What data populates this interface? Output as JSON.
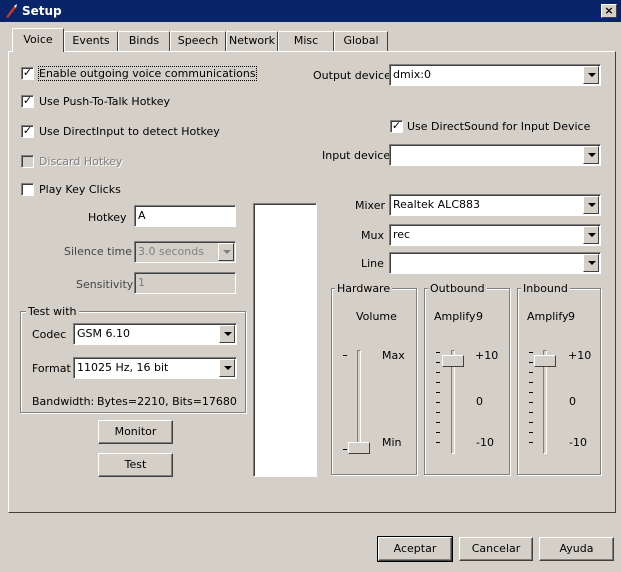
{
  "window": {
    "title": "Setup",
    "close_glyph": "×"
  },
  "tabs": [
    "Voice",
    "Events",
    "Binds",
    "Speech",
    "Network",
    "Misc",
    "Global"
  ],
  "voice": {
    "enable_outgoing": {
      "label": "Enable outgoing voice communications",
      "checked": true
    },
    "push_to_talk": {
      "label": "Use Push-To-Talk Hotkey",
      "checked": true
    },
    "direct_input": {
      "label": "Use DirectInput to detect Hotkey",
      "checked": true
    },
    "discard_hotkey": {
      "label": "Discard Hotkey",
      "checked": false,
      "disabled": true
    },
    "play_key_clicks": {
      "label": "Play Key Clicks",
      "checked": false
    },
    "hotkey": {
      "label": "Hotkey",
      "value": "A"
    },
    "silence_time": {
      "label": "Silence time",
      "value": "3.0 seconds"
    },
    "sensitivity": {
      "label": "Sensitivity",
      "value": "1"
    },
    "test_with": {
      "title": "Test with",
      "codec_label": "Codec",
      "codec_value": "GSM 6.10",
      "format_label": "Format",
      "format_value": "11025 Hz, 16 bit",
      "bandwidth_label": "Bandwidth:",
      "bandwidth_value": "Bytes=2210, Bits=17680"
    },
    "monitor_button": "Monitor",
    "test_button": "Test",
    "output_device": {
      "label": "Output device",
      "value": "dmix:0"
    },
    "use_directsound": {
      "label": "Use DirectSound for Input Device",
      "checked": true
    },
    "input_device": {
      "label": "Input device",
      "value": ""
    },
    "mixer": {
      "label": "Mixer",
      "value": "Realtek ALC883"
    },
    "mux": {
      "label": "Mux",
      "value": "rec"
    },
    "line": {
      "label": "Line",
      "value": ""
    },
    "hardware": {
      "title": "Hardware",
      "caption": "Volume",
      "max": "Max",
      "min": "Min",
      "level": 0.0
    },
    "outbound": {
      "title": "Outbound",
      "caption": "Amplify",
      "amount": "9",
      "top": "+10",
      "mid": "0",
      "bottom": "-10",
      "level": 0.95
    },
    "inbound": {
      "title": "Inbound",
      "caption": "Amplify",
      "amount": "9",
      "top": "+10",
      "mid": "0",
      "bottom": "-10",
      "level": 0.95
    }
  },
  "footer": {
    "accept": "Aceptar",
    "cancel": "Cancelar",
    "help": "Ayuda"
  },
  "icons": {
    "app": "pencil-quill-icon"
  },
  "colors": {
    "titlebar": "#0a246a",
    "face": "#d4d0c8"
  }
}
